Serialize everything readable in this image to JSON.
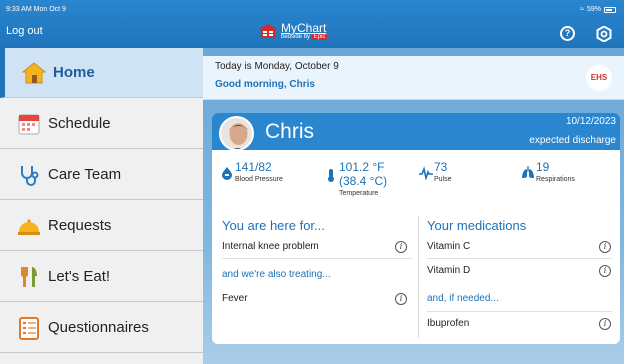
{
  "status_bar": {
    "time": "9:33 AM  Mon Oct 9",
    "battery": "59%"
  },
  "header": {
    "logout": "Log out",
    "logo_main": "MyChart",
    "logo_sub": "bedside",
    "logo_brand": "Epic",
    "help_icon": "help-icon",
    "settings_icon": "gear-icon"
  },
  "sidebar": {
    "items": [
      {
        "label": "Home",
        "icon": "home-icon",
        "active": true
      },
      {
        "label": "Schedule",
        "icon": "calendar-icon"
      },
      {
        "label": "Care Team",
        "icon": "stethoscope-icon"
      },
      {
        "label": "Requests",
        "icon": "bell-icon"
      },
      {
        "label": "Let's Eat!",
        "icon": "utensils-icon"
      },
      {
        "label": "Questionnaires",
        "icon": "clipboard-icon"
      }
    ]
  },
  "banner": {
    "date_text": "Today is Monday, October 9",
    "greeting": "Good morning, Chris",
    "logo_text": "EHS"
  },
  "patient": {
    "name": "Chris",
    "discharge_date": "10/12/2023",
    "discharge_label": "expected discharge"
  },
  "vitals": [
    {
      "value": "141/82",
      "label": "Blood Pressure",
      "icon": "blood-pressure-icon"
    },
    {
      "value": "101.2 °F",
      "value2": "(38.4 °C)",
      "label": "Temperature",
      "icon": "thermometer-icon"
    },
    {
      "value": "73",
      "label": "Pulse",
      "icon": "pulse-icon"
    },
    {
      "value": "19",
      "label": "Respirations",
      "icon": "lungs-icon"
    }
  ],
  "here_for": {
    "title": "You are here for...",
    "items": [
      "Internal knee problem"
    ],
    "also_title": "and we're also treating...",
    "also_items": [
      "Fever"
    ]
  },
  "medications": {
    "title": "Your medications",
    "items": [
      "Vitamin C",
      "Vitamin D"
    ],
    "if_needed_title": "and, if needed...",
    "if_needed_items": [
      "Ibuprofen"
    ]
  },
  "colors": {
    "brand": "#1d72b8",
    "header": "#2a86cf",
    "sidebar_active": "#cfe3f4"
  }
}
